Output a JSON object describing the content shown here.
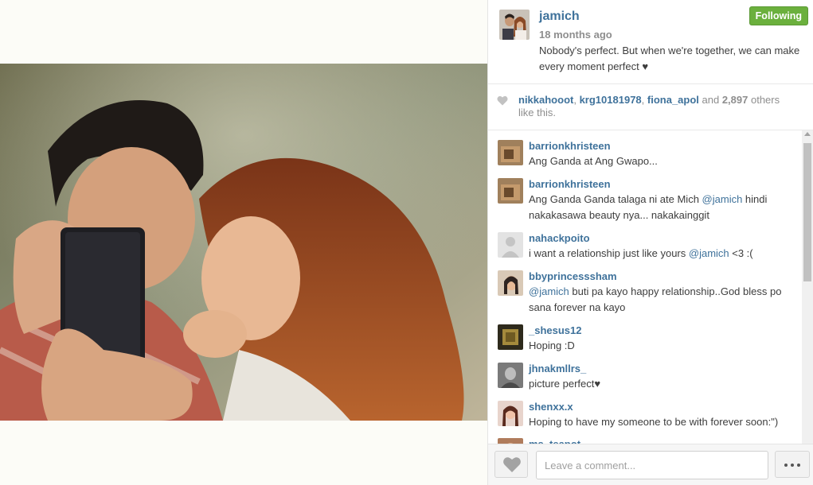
{
  "post": {
    "username": "jamich",
    "time_ago": "18 months ago",
    "caption": "Nobody's perfect. But when we're together, we can make every moment perfect ♥",
    "follow_label": "Following",
    "image_alt": "couple selfie photo"
  },
  "likes": {
    "user1": "nikkahooot",
    "sep1": ", ",
    "user2": "krg10181978",
    "sep2": ", ",
    "user3": "fiona_apol",
    "and": " and ",
    "count": "2,897",
    "suffix": " others like this."
  },
  "comments": [
    {
      "user": "barrionkhristeen",
      "text": "Ang Ganda at Ang Gwapo..."
    },
    {
      "user": "barrionkhristeen",
      "text_before": "Ang Ganda Ganda talaga ni ate Mich ",
      "mention": "@jamich",
      "text_after": " hindi nakakasawa beauty nya... nakakainggit"
    },
    {
      "user": "nahackpoito",
      "text_before": "i want a relationship just like yours ",
      "mention": "@jamich",
      "text_after": " <3 :("
    },
    {
      "user": "bbyprincesssham",
      "mention": "@jamich",
      "text_after": " buti pa kayo happy relationship..God bless po sana forever na kayo"
    },
    {
      "user": "_shesus12",
      "text": "Hoping :D"
    },
    {
      "user": "jhnakmllrs_",
      "text": "picture perfect♥"
    },
    {
      "user": "shenxx.x",
      "text": "Hoping to have my someone to be with forever soon:\")"
    },
    {
      "user": "ms_teapot",
      "text": ""
    }
  ],
  "comment_box": {
    "placeholder": "Leave a comment..."
  },
  "icons": {
    "like": "heart-icon",
    "more": "more-dots-icon"
  },
  "colors": {
    "username": "#3f729b",
    "follow_button": "#6bb03d"
  }
}
